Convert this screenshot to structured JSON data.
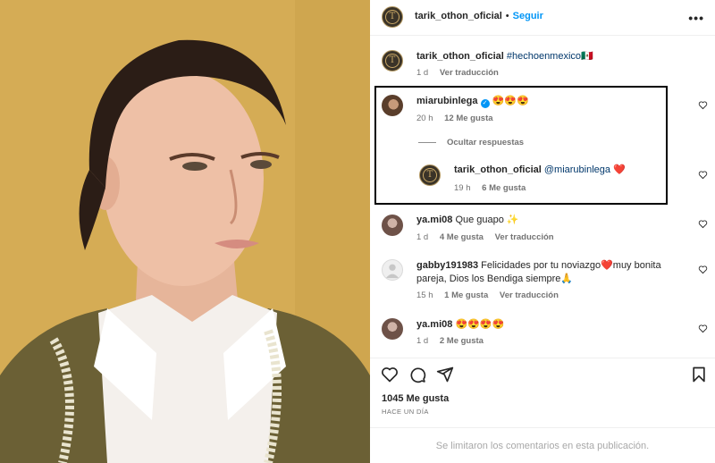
{
  "post": {
    "author": "tarik_othon_oficial",
    "follow_label": "Seguir",
    "more_label": "•••",
    "caption_user": "tarik_othon_oficial",
    "caption_text": "#hechoenmexico🇲🇽",
    "caption_time": "1 d",
    "caption_translate": "Ver traducción"
  },
  "comments": [
    {
      "user": "miarubinlega",
      "verified": true,
      "text": "😍😍😍",
      "time": "20 h",
      "likes": "12 Me gusta",
      "translate": ""
    },
    {
      "user": "tarik_othon_oficial",
      "mention": "@miarubinlega",
      "text": "❤️",
      "time": "19 h",
      "likes": "6 Me gusta",
      "translate": ""
    },
    {
      "user": "ya.mi08",
      "text": "Que guapo ✨",
      "time": "1 d",
      "likes": "4 Me gusta",
      "translate": "Ver traducción"
    },
    {
      "user": "gabby191983",
      "text": "Felicidades por tu noviazgo❤️muy bonita pareja, Dios los Bendiga siempre🙏",
      "time": "15 h",
      "likes": "1 Me gusta",
      "translate": "Ver traducción"
    },
    {
      "user": "ya.mi08",
      "text": "😍😍😍😍",
      "time": "1 d",
      "likes": "2 Me gusta",
      "translate": ""
    }
  ],
  "replies": {
    "hide_label": "Ocultar respuestas"
  },
  "footer": {
    "likes": "1045 Me gusta",
    "time": "HACE UN DÍA",
    "comments_limited": "Se limitaron los comentarios en esta publicación."
  },
  "colors": {
    "link": "#0095f6",
    "verified": "#0095f6",
    "text": "#262626",
    "muted": "#737373"
  }
}
